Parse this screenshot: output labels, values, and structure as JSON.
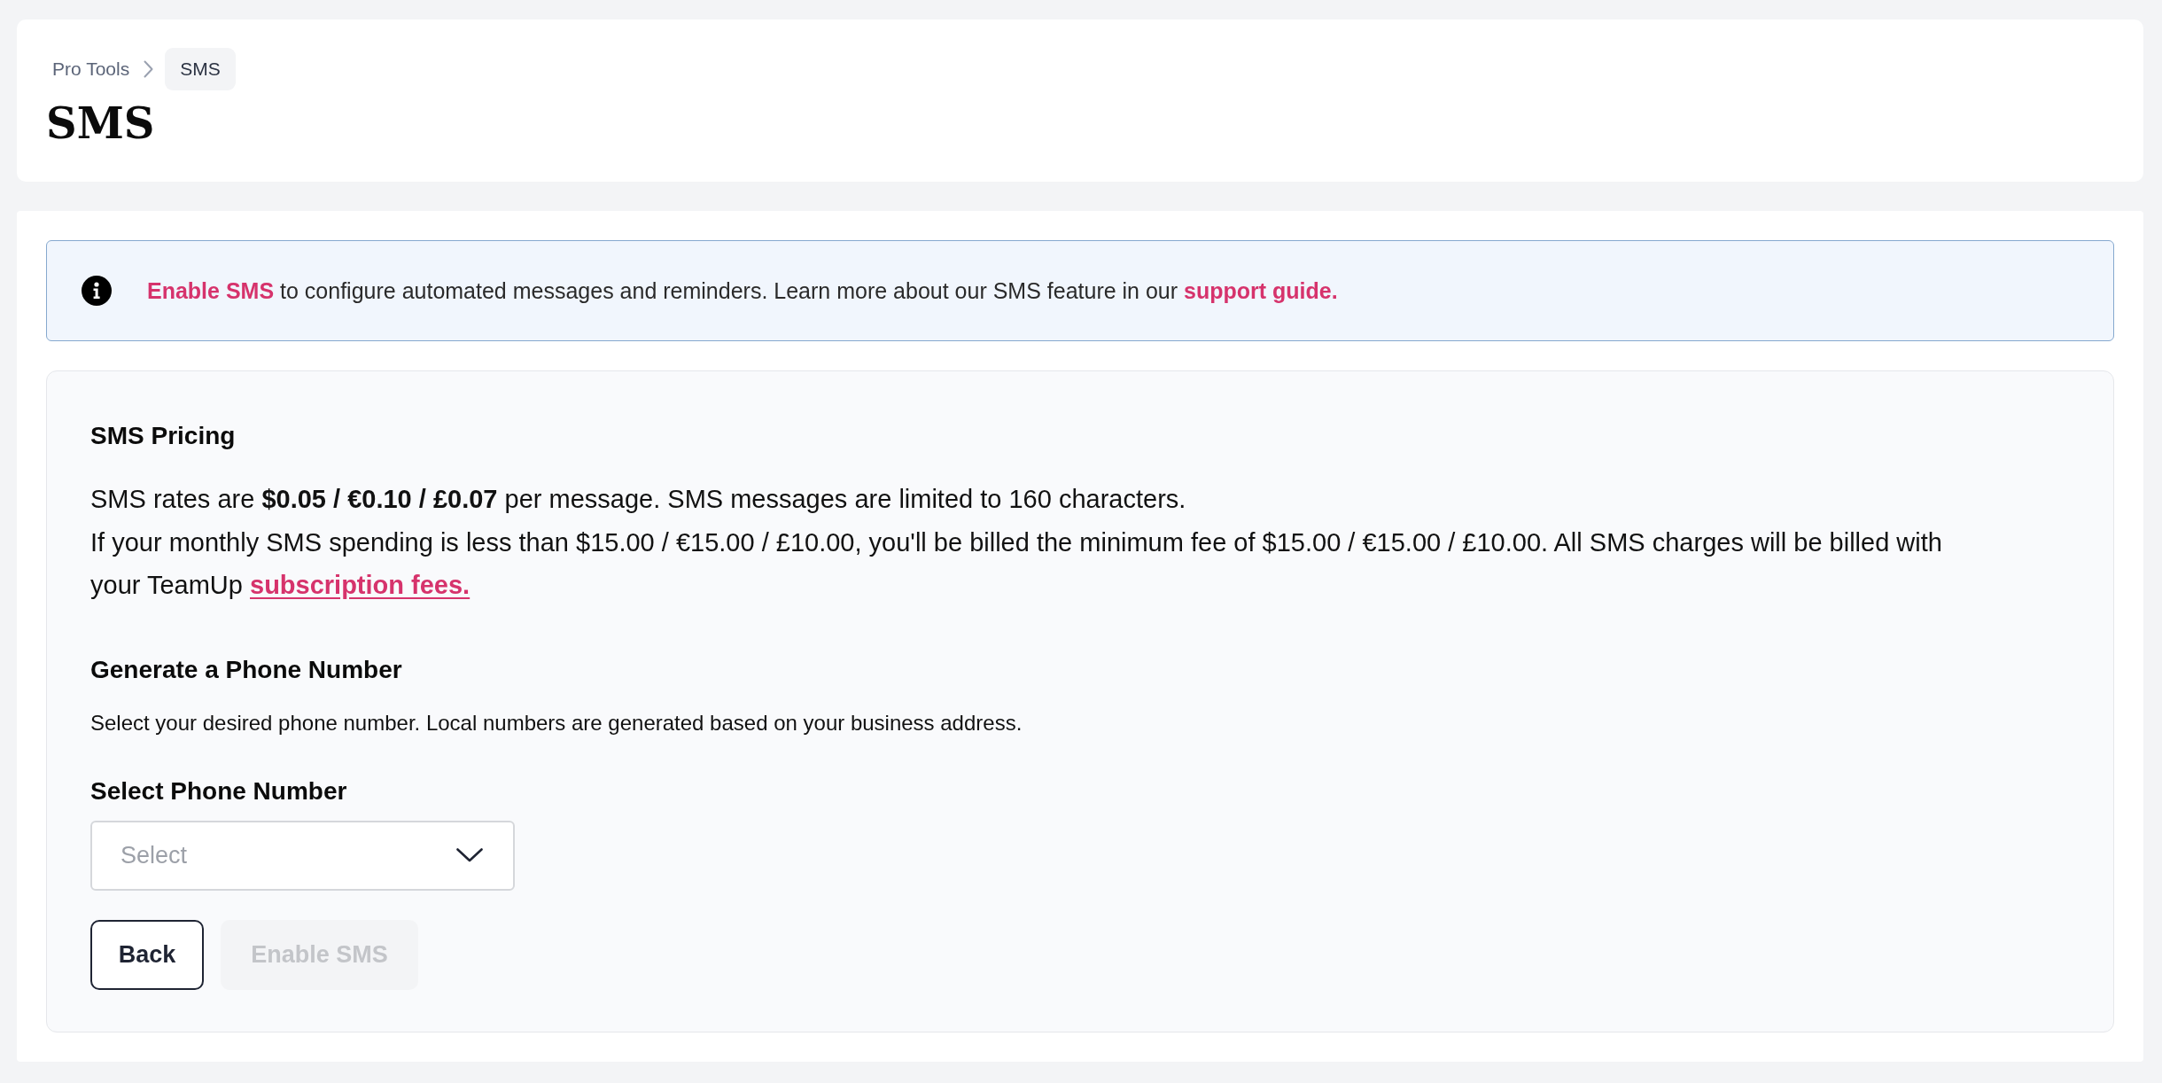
{
  "breadcrumb": [
    {
      "label": "Pro Tools",
      "current": false
    },
    {
      "label": "SMS",
      "current": true
    }
  ],
  "page_title": "SMS",
  "info_banner": {
    "segments": [
      {
        "kind": "link",
        "text": "Enable SMS"
      },
      {
        "kind": "text",
        "text": " to configure automated messages and reminders. Learn more about our SMS feature in our "
      },
      {
        "kind": "link",
        "text": "support guide."
      }
    ]
  },
  "pricing": {
    "heading": "SMS Pricing",
    "paragraphs": [
      [
        {
          "kind": "text",
          "text": "SMS rates are **$0.05 / €0.10 / £0.07** per message. SMS messages are limited to 160 characters."
        }
      ],
      [
        {
          "kind": "text",
          "text": "If your monthly SMS spending is less than $15.00 / €15.00 / £10.00, you'll be billed the minimum fee of $15.00 / €15.00 / £10.00. All SMS charges will be billed with your TeamUp "
        },
        {
          "kind": "link",
          "text": "subscription fees."
        }
      ]
    ]
  },
  "phone_number": {
    "heading": "Generate a Phone Number",
    "description": "Select your desired phone number. Local numbers are generated based on your business address.",
    "field_label": "Select Phone Number",
    "select": {
      "placeholder": "Select"
    }
  },
  "buttons": [
    {
      "label": "Back",
      "kind": "back",
      "disabled": false
    },
    {
      "label": "Enable SMS",
      "kind": "submit",
      "disabled": true
    }
  ]
}
